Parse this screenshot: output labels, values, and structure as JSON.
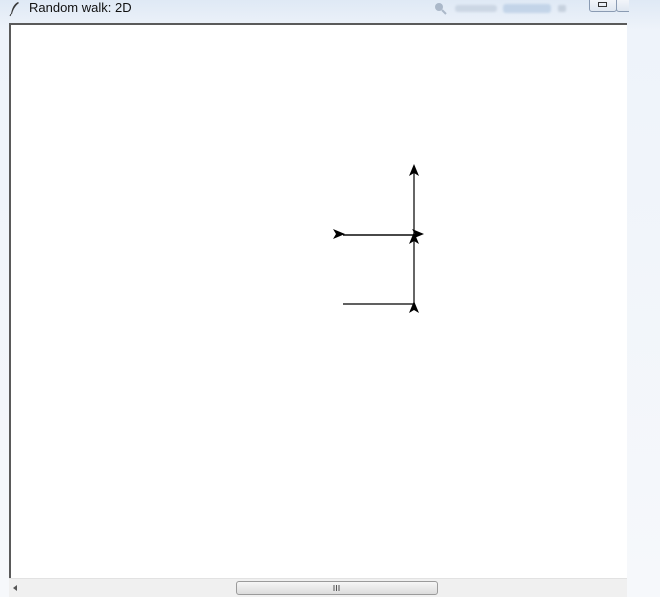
{
  "window": {
    "title": "Random walk: 2D",
    "app_icon": "feather-icon"
  },
  "titlebar_controls": [
    "search-icon",
    "minimize-icon",
    "maximize-icon"
  ],
  "walk": {
    "heading_markers": [
      "right",
      "up",
      "up",
      "right",
      "up"
    ],
    "colors": {
      "path": "#000000",
      "background": "#ffffff"
    }
  },
  "scrollbar": {
    "orientation": "horizontal",
    "left_arrow": "left-arrow-icon",
    "grip": "grip-icon"
  }
}
